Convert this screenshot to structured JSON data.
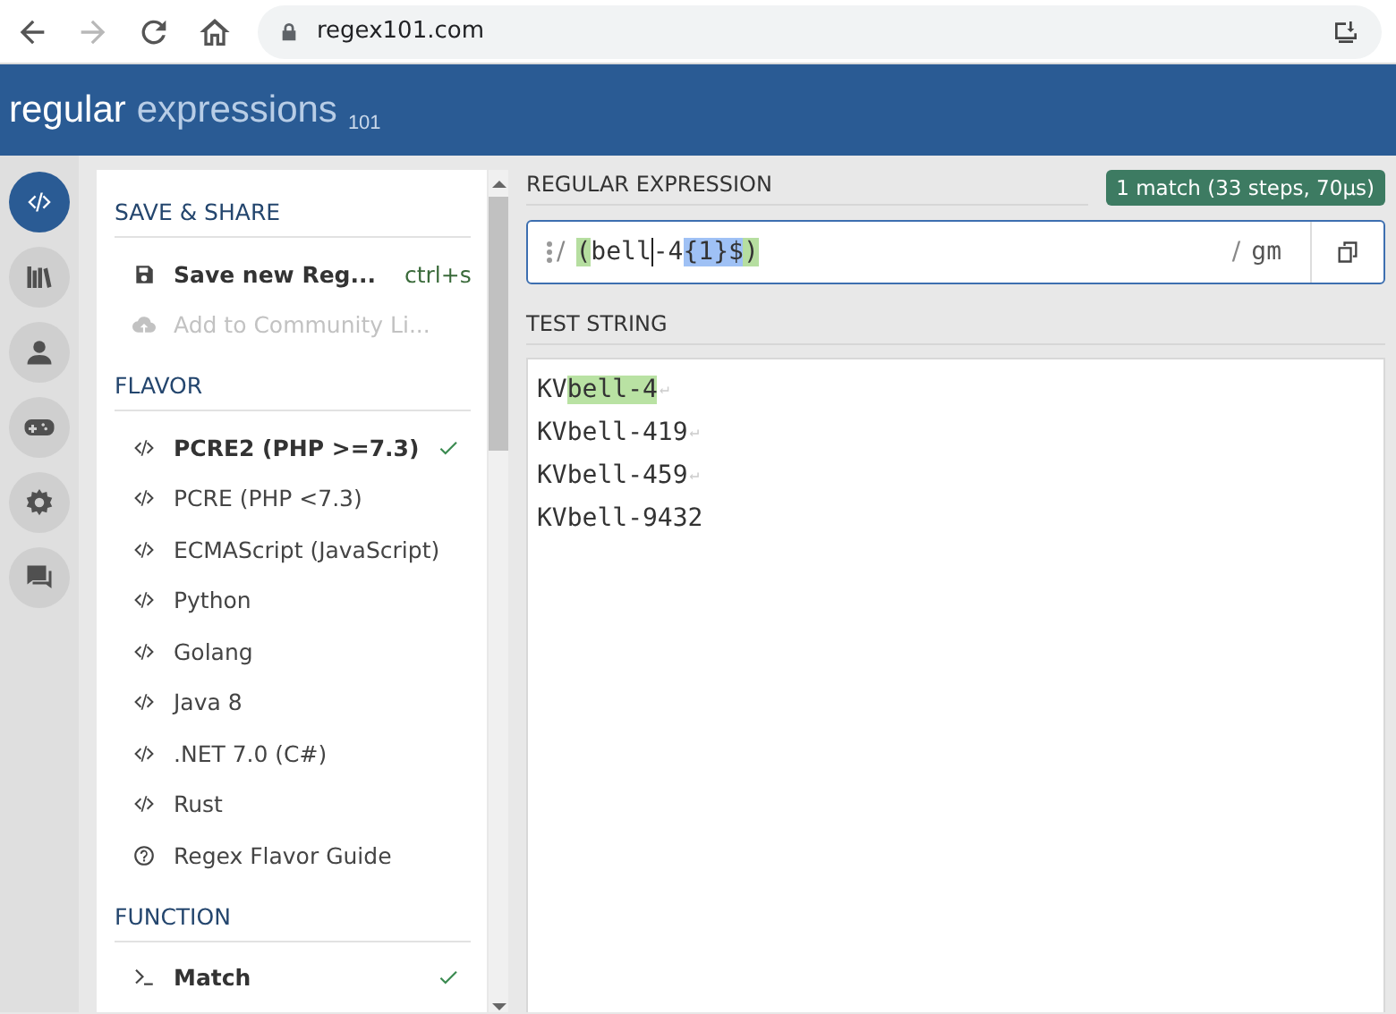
{
  "browser": {
    "url": "regex101.com",
    "nav": [
      {
        "kind": "back",
        "disabled": false
      },
      {
        "kind": "forward",
        "disabled": true
      },
      {
        "kind": "reload",
        "disabled": false
      },
      {
        "kind": "home",
        "disabled": false
      }
    ]
  },
  "header": {
    "title": "regular",
    "subtitle": "expressions",
    "version": "101"
  },
  "rail": [
    {
      "kind": "code",
      "selected": true
    },
    {
      "kind": "library",
      "selected": false
    },
    {
      "kind": "user",
      "selected": false
    },
    {
      "kind": "gamepad",
      "selected": false
    },
    {
      "kind": "gear",
      "selected": false
    },
    {
      "kind": "chat",
      "selected": false
    }
  ],
  "sidebar": {
    "sections": [
      {
        "title": "SAVE & SHARE",
        "items": [
          {
            "kind": "save",
            "label": "Save new Reg...",
            "shortcut": "ctrl+s",
            "disabled": false,
            "bold": true
          },
          {
            "kind": "upload",
            "label": "Add to Community Li...",
            "disabled": true,
            "bold": false
          }
        ]
      },
      {
        "title": "FLAVOR",
        "items": [
          {
            "kind": "code",
            "label": "PCRE2 (PHP >=7.3)",
            "selected": true
          },
          {
            "kind": "code",
            "label": "PCRE (PHP <7.3)",
            "selected": false
          },
          {
            "kind": "code",
            "label": "ECMAScript (JavaScript)",
            "selected": false
          },
          {
            "kind": "code",
            "label": "Python",
            "selected": false
          },
          {
            "kind": "code",
            "label": "Golang",
            "selected": false
          },
          {
            "kind": "code",
            "label": "Java 8",
            "selected": false
          },
          {
            "kind": "code",
            "label": ".NET 7.0 (C#)",
            "selected": false
          },
          {
            "kind": "code",
            "label": "Rust",
            "selected": false
          },
          {
            "kind": "help",
            "label": "Regex Flavor Guide",
            "selected": false
          }
        ]
      },
      {
        "title": "FUNCTION",
        "items": [
          {
            "kind": "terminal",
            "label": "Match",
            "selected": true
          }
        ]
      }
    ]
  },
  "regex": {
    "label": "REGULAR EXPRESSION",
    "match_info": "1 match (33 steps, 70µs)",
    "open_delimiter": "/",
    "close_delimiter": "/",
    "flags": "gm",
    "tokens": [
      {
        "text": "(",
        "color": "#b6dea0"
      },
      {
        "text": "bell"
      },
      {
        "text": "-4",
        "cursor_before": true
      },
      {
        "text": "{1}$",
        "color": "#9fc1f5"
      },
      {
        "text": ")",
        "color": "#b6dea0"
      }
    ]
  },
  "test_string": {
    "label": "TEST STRING",
    "lines": [
      {
        "segments": [
          {
            "text": "KV",
            "matched": false
          },
          {
            "text": "bell-4",
            "matched": true
          }
        ],
        "end_mark": "↵"
      },
      {
        "segments": [
          {
            "text": "KVbell-419",
            "matched": false
          }
        ],
        "end_mark": "↵"
      },
      {
        "segments": [
          {
            "text": "KVbell-459",
            "matched": false
          }
        ],
        "end_mark": "↵"
      },
      {
        "segments": [
          {
            "text": "KVbell-9432",
            "matched": false
          }
        ]
      }
    ]
  }
}
